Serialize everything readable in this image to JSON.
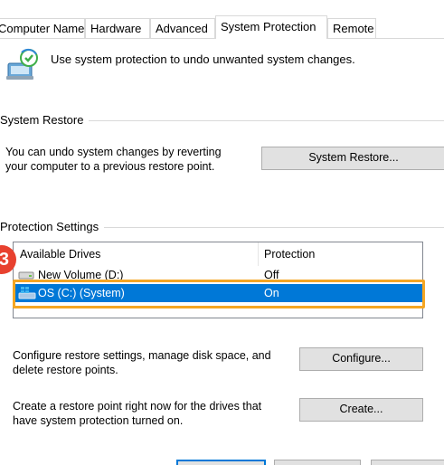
{
  "tabs": [
    {
      "label": "Computer Name"
    },
    {
      "label": "Hardware"
    },
    {
      "label": "Advanced"
    },
    {
      "label": "System Protection"
    },
    {
      "label": "Remote"
    }
  ],
  "header": {
    "text": "Use system protection to undo unwanted system changes."
  },
  "system_restore": {
    "group_label": "System Restore",
    "description_line1": "You can undo system changes by reverting",
    "description_line2": "your computer to a previous restore point.",
    "button_label": "System Restore..."
  },
  "protection": {
    "group_label": "Protection Settings",
    "columns": {
      "drives": "Available Drives",
      "protection": "Protection"
    },
    "rows": [
      {
        "drive": "New Volume (D:)",
        "status": "Off"
      },
      {
        "drive": "OS (C:) (System)",
        "status": "On"
      }
    ],
    "configure_desc_line1": "Configure restore settings, manage disk space, and",
    "configure_desc_line2": "delete restore points.",
    "configure_button": "Configure...",
    "create_desc_line1": "Create a restore point right now for the drives that",
    "create_desc_line2": "have system protection turned on.",
    "create_button": "Create..."
  },
  "annotation": {
    "badge": "3",
    "color": "#f5a623",
    "badge_color": "#e8412f"
  },
  "colors": {
    "selection": "#0078d7"
  }
}
